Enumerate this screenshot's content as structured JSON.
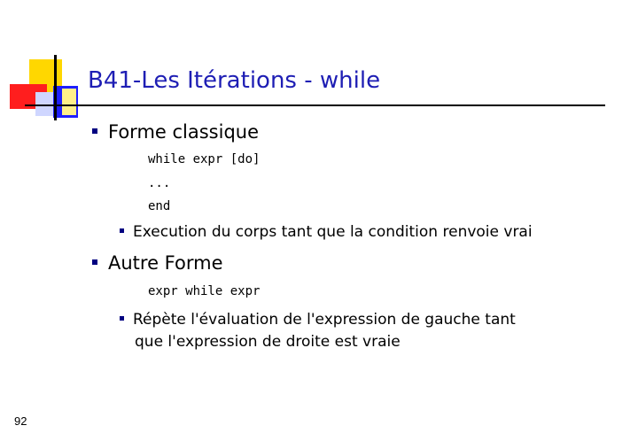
{
  "slide": {
    "title": "B41-Les Itérations - while",
    "page_number": "92",
    "sections": [
      {
        "heading": "Forme classique",
        "code_lines": [
          "while expr [do]",
          "...",
          "end"
        ],
        "note": "Execution du corps tant que la condition renvoie vrai"
      },
      {
        "heading": "Autre Forme",
        "code_lines": [
          "expr while expr"
        ],
        "note_line1": "Répète l'évaluation de l'expression de gauche tant",
        "note_line2": "que l'expression de droite est vraie"
      }
    ]
  },
  "colors": {
    "title": "#1e1eb4",
    "bullet": "#000080",
    "deco_yellow": "#ffd700",
    "deco_red": "#ff1e1e",
    "deco_blue": "#1e1eff"
  }
}
